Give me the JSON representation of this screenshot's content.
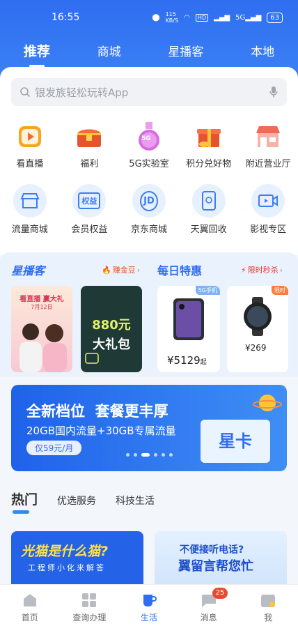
{
  "status": {
    "time": "16:55",
    "net_speed": "115\nKB/S",
    "battery": "63"
  },
  "top_tabs": [
    "推荐",
    "商城",
    "星播客",
    "本地"
  ],
  "search": {
    "placeholder": "银发族轻松玩转App"
  },
  "grid_row1": [
    {
      "label": "看直播",
      "icon": "live-icon"
    },
    {
      "label": "福利",
      "icon": "treasure-chest-icon"
    },
    {
      "label": "5G实验室",
      "icon": "flask-icon",
      "icon_text": "5G"
    },
    {
      "label": "积分兑好物",
      "icon": "gift-icon"
    },
    {
      "label": "附近营业厅",
      "icon": "store-icon"
    }
  ],
  "grid_row2": [
    {
      "label": "流量商城",
      "icon": "shop-icon"
    },
    {
      "label": "会员权益",
      "icon": "rights-icon",
      "icon_text": "权益"
    },
    {
      "label": "京东商城",
      "icon": "jd-icon",
      "icon_text": "JD"
    },
    {
      "label": "天翼回收",
      "icon": "recycle-icon"
    },
    {
      "label": "影视专区",
      "icon": "video-icon"
    }
  ],
  "promo": {
    "xingboke_title": "星播客",
    "xingboke_tag": "赚金豆",
    "live_thumb": {
      "title": "看直播 赢大礼",
      "date": "7月12日"
    },
    "gift_thumb": {
      "amount": "880元",
      "name": "大礼包"
    },
    "daily_title": "每日特惠",
    "flash_tag": "限时秒杀",
    "product1": {
      "badge": "5G手机",
      "price": "¥5129",
      "suffix": "起"
    },
    "product2": {
      "badge": "限时",
      "price": "¥269"
    }
  },
  "banner": {
    "headline": "全新档位  套餐更丰厚",
    "sub": "20GB国内流量+30GB专属流量",
    "price": "仅59元/月",
    "card_text": "星卡"
  },
  "section_tabs": [
    "热门",
    "优选服务",
    "科技生活"
  ],
  "tile1": {
    "title": "光猫是什么猫?",
    "sub": "工程师小化来解答"
  },
  "tile2": {
    "line1": "不便接听电话?",
    "line2": "翼留言帮您忙"
  },
  "nav": [
    {
      "label": "首页",
      "icon": "home-icon"
    },
    {
      "label": "查询办理",
      "icon": "grid-icon"
    },
    {
      "label": "生活",
      "icon": "cup-icon"
    },
    {
      "label": "消息",
      "icon": "message-icon",
      "badge": "25"
    },
    {
      "label": "我",
      "icon": "profile-icon"
    }
  ],
  "colors": {
    "brand": "#2f6ef0",
    "accent": "#e84a2f"
  }
}
